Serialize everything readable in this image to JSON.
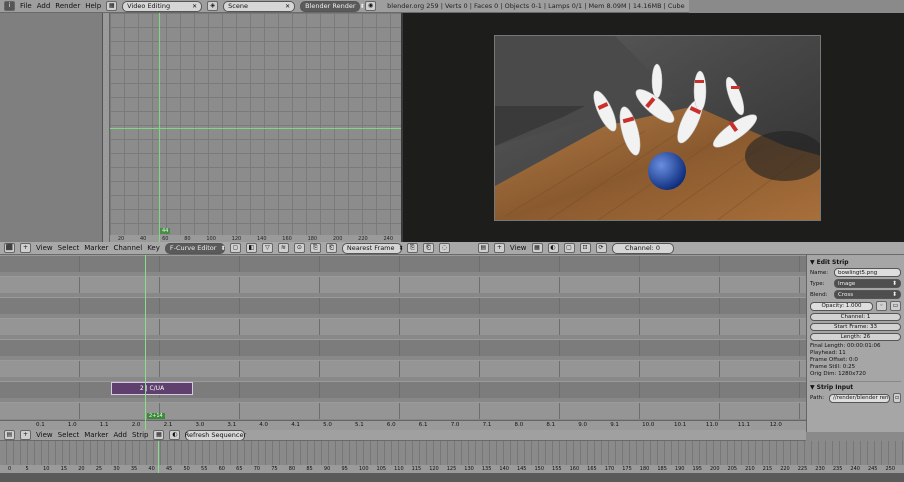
{
  "topbar": {
    "menus": [
      "File",
      "Add",
      "Render",
      "Help"
    ],
    "screen": "Video Editing",
    "scene": "Scene",
    "engine": "Blender Render",
    "info": "blender.org 259 | Verts 0 | Faces 0 | Objects 0-1 | Lamps 0/1 | Mem 8.09M | 14.16MB | Cube"
  },
  "graph": {
    "hscale": [
      "20",
      "40",
      "60",
      "80",
      "100",
      "120",
      "140",
      "160",
      "180",
      "200",
      "220",
      "240"
    ],
    "frame": "44"
  },
  "preview": {
    "image": "bowling pins and ball on wooden lane"
  },
  "midbar": {
    "menus": [
      "View",
      "Select",
      "Marker",
      "Channel",
      "Key"
    ],
    "mode": "F-Curve Editor",
    "filter": "Nearest Frame",
    "view_menu": "View",
    "channel": "Channel: 0"
  },
  "sequencer": {
    "strip_label": "2 | C/UA",
    "frame_label": "2+14",
    "ruler": [
      "0.1",
      "1.0",
      "1.1",
      "2.0",
      "2.1",
      "3.0",
      "3.1",
      "4.0",
      "4.1",
      "5.0",
      "5.1",
      "6.0",
      "6.1",
      "7.0",
      "7.1",
      "8.0",
      "8.1",
      "9.0",
      "9.1",
      "10.0",
      "10.1",
      "11.0",
      "11.1",
      "12.0"
    ]
  },
  "panel": {
    "edit_strip": "Edit Strip",
    "name_label": "Name:",
    "name": "bowlingt5.png",
    "type_label": "Type:",
    "type": "Image",
    "blend_label": "Blend:",
    "blend": "Cross",
    "opacity": "Opacity: 1.000",
    "channel": "Channel: 1",
    "start": "Start Frame: 33",
    "length": "Length: 26",
    "final_length": "Final Length: 00:00:01:06",
    "playhead": "Playhead: 11",
    "offset": "Frame Offset: 0:0",
    "still": "Frame Still: 0:25",
    "orig_dim": "Orig Dim: 1280x720",
    "strip_input": "Strip Input",
    "path_label": "Path:",
    "path": "//render/blender render/"
  },
  "botbar": {
    "menus": [
      "View",
      "Select",
      "Marker",
      "Add",
      "Strip"
    ],
    "refresh": "Refresh Sequencer"
  },
  "timeline": {
    "ticks": [
      "0",
      "5",
      "10",
      "15",
      "20",
      "25",
      "30",
      "35",
      "40",
      "45",
      "50",
      "55",
      "60",
      "65",
      "70",
      "75",
      "80",
      "85",
      "90",
      "95",
      "100",
      "105",
      "110",
      "115",
      "120",
      "125",
      "130",
      "135",
      "140",
      "145",
      "150",
      "155",
      "160",
      "165",
      "170",
      "175",
      "180",
      "185",
      "190",
      "195",
      "200",
      "205",
      "210",
      "215",
      "220",
      "225",
      "230",
      "235",
      "240",
      "245",
      "250"
    ]
  },
  "colors": {
    "playhead": "#86e086",
    "strip": "#5e3f6e"
  }
}
